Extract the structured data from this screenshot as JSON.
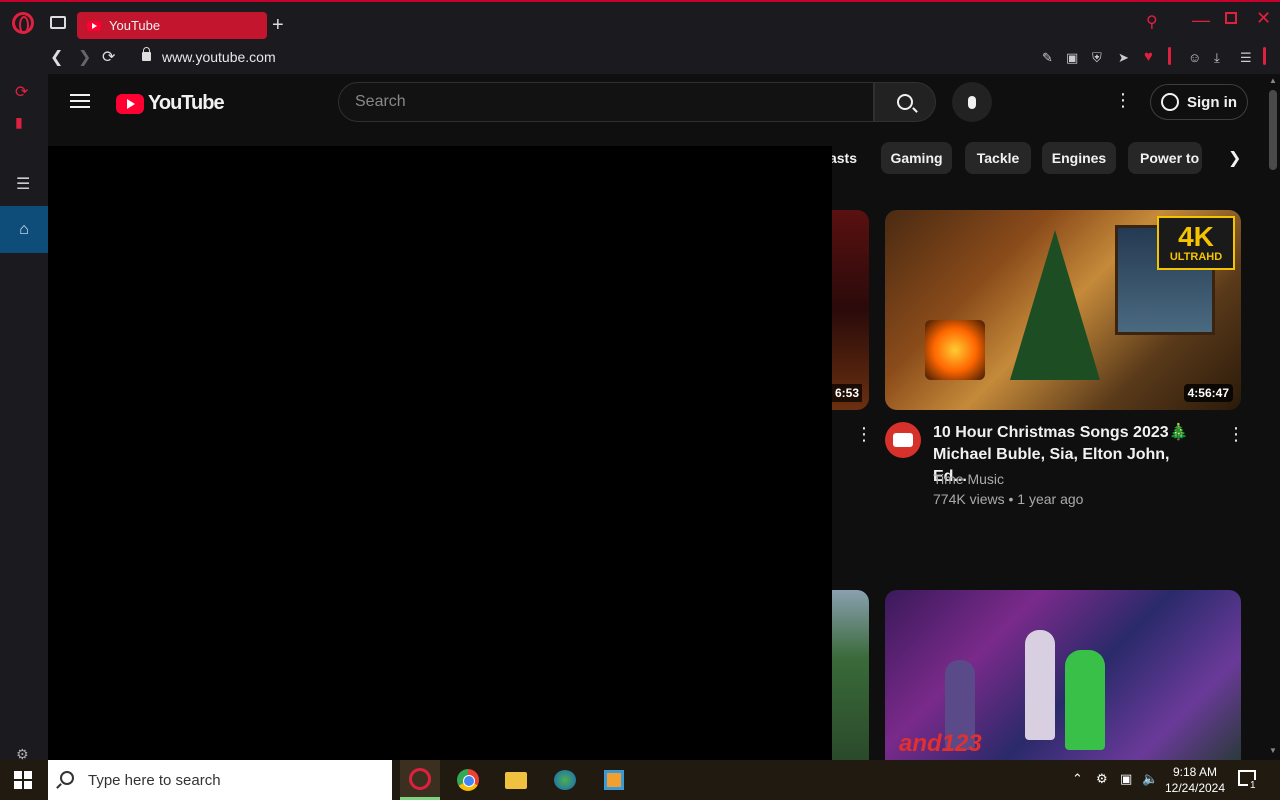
{
  "browser": {
    "tab_title": "YouTube",
    "url": "www.youtube.com",
    "accent_color": "#e0203f"
  },
  "youtube": {
    "wordmark": "YouTube",
    "search_placeholder": "Search",
    "sign_in_label": "Sign in",
    "chips": [
      "asts",
      "Gaming",
      "Tackle",
      "Engines",
      "Power to"
    ],
    "videos": [
      {
        "title": "10 Hour Christmas Songs 2023🎄Michael Buble, Sia, Elton John, Ed...",
        "channel": "Time Music",
        "meta": "774K views • 1 year ago",
        "duration": "4:56:47",
        "badge_main": "4K",
        "badge_sub": "ULTRAHD"
      }
    ],
    "left_video_duration": "6:53",
    "thumb2_overlay_text": "and123"
  },
  "taskbar": {
    "search_placeholder": "Type here to search",
    "time": "9:18 AM",
    "date": "12/24/2024",
    "notification_count": "1"
  }
}
